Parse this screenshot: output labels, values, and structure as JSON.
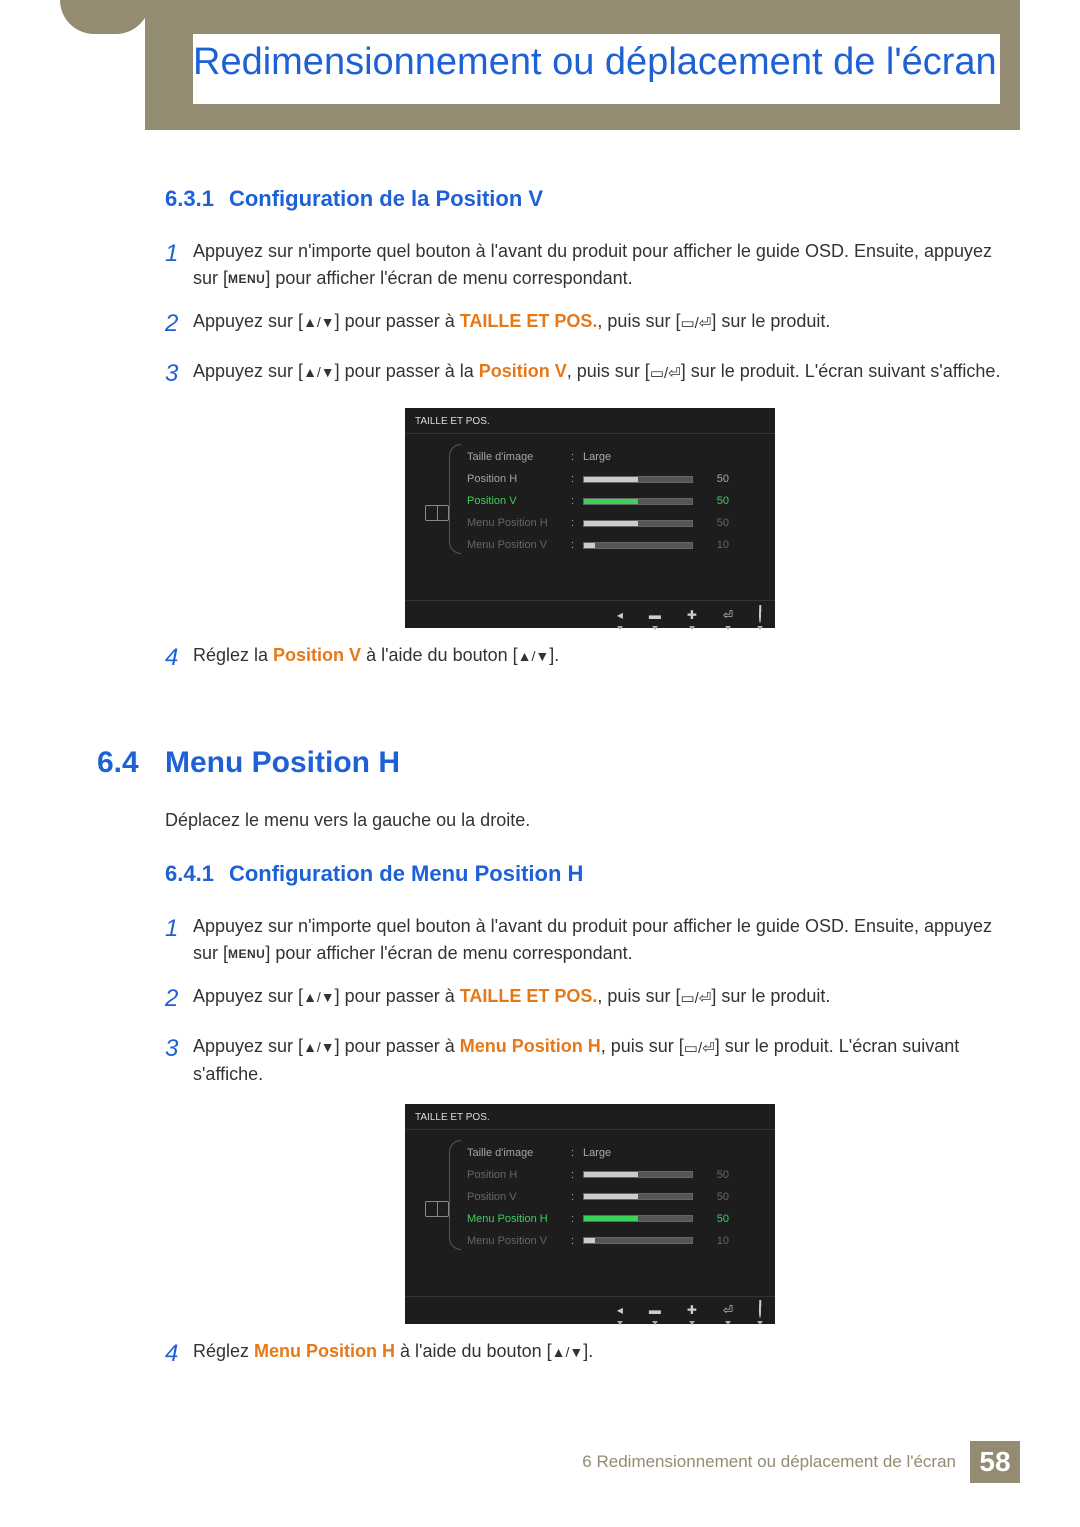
{
  "chapter_title": "Redimensionnement ou déplacement de l'écran",
  "section_631": {
    "num": "6.3.1",
    "title": "Configuration de la Position V",
    "steps": {
      "s1a": "Appuyez sur n'importe quel bouton à l'avant du produit pour afficher le guide OSD. Ensuite, appuyez sur [",
      "menu": "MENU",
      "s1b": "] pour afficher l'écran de menu correspondant.",
      "s2a": "Appuyez sur [",
      "s2b": "] pour passer à ",
      "s2hl": "TAILLE ET POS.",
      "s2c": ", puis sur [",
      "s2d": "] sur le produit.",
      "s3a": "Appuyez sur [",
      "s3b": "] pour passer à la ",
      "s3hl": "Position V",
      "s3c": ", puis sur [",
      "s3d": "] sur le produit. L'écran suivant s'affiche.",
      "s4a": "Réglez la ",
      "s4hl": "Position V",
      "s4b": " à l'aide du bouton [",
      "s4c": "]."
    }
  },
  "section_64": {
    "num": "6.4",
    "title": "Menu Position H",
    "intro": "Déplacez le menu vers la gauche ou la droite."
  },
  "section_641": {
    "num": "6.4.1",
    "title": "Configuration de Menu Position H",
    "steps": {
      "s1a": "Appuyez sur n'importe quel bouton à l'avant du produit pour afficher le guide OSD. Ensuite, appuyez sur [",
      "menu": "MENU",
      "s1b": "] pour afficher l'écran de menu correspondant.",
      "s2a": "Appuyez sur [",
      "s2b": "] pour passer à ",
      "s2hl": "TAILLE ET POS.",
      "s2c": ", puis sur [",
      "s2d": "] sur le produit.",
      "s3a": "Appuyez sur [",
      "s3b": "] pour passer à ",
      "s3hl": "Menu Position H",
      "s3c": ", puis sur [",
      "s3d": "] sur le produit. L'écran suivant s'affiche.",
      "s4a": "Réglez ",
      "s4hl": "Menu Position H",
      "s4b": " à l'aide du bouton [",
      "s4c": "]."
    }
  },
  "osd1": {
    "title": "TAILLE ET POS.",
    "rows": [
      {
        "label": "Taille d'image",
        "value_text": "Large",
        "percent": null,
        "num": "",
        "sel": false,
        "dim": false
      },
      {
        "label": "Position H",
        "value_text": "",
        "percent": 50,
        "num": "50",
        "sel": false,
        "dim": false
      },
      {
        "label": "Position V",
        "value_text": "",
        "percent": 50,
        "num": "50",
        "sel": true,
        "dim": false
      },
      {
        "label": "Menu Position H",
        "value_text": "",
        "percent": 50,
        "num": "50",
        "sel": false,
        "dim": true
      },
      {
        "label": "Menu Position V",
        "value_text": "",
        "percent": 10,
        "num": "10",
        "sel": false,
        "dim": true
      }
    ]
  },
  "osd2": {
    "title": "TAILLE ET POS.",
    "rows": [
      {
        "label": "Taille d'image",
        "value_text": "Large",
        "percent": null,
        "num": "",
        "sel": false,
        "dim": false
      },
      {
        "label": "Position H",
        "value_text": "",
        "percent": 50,
        "num": "50",
        "sel": false,
        "dim": true
      },
      {
        "label": "Position V",
        "value_text": "",
        "percent": 50,
        "num": "50",
        "sel": false,
        "dim": true
      },
      {
        "label": "Menu Position H",
        "value_text": "",
        "percent": 50,
        "num": "50",
        "sel": true,
        "dim": false
      },
      {
        "label": "Menu Position V",
        "value_text": "",
        "percent": 10,
        "num": "10",
        "sel": false,
        "dim": true
      }
    ]
  },
  "footer": {
    "text": "6 Redimensionnement ou déplacement de l'écran",
    "page": "58"
  },
  "step_nums": {
    "n1": "1",
    "n2": "2",
    "n3": "3",
    "n4": "4"
  }
}
